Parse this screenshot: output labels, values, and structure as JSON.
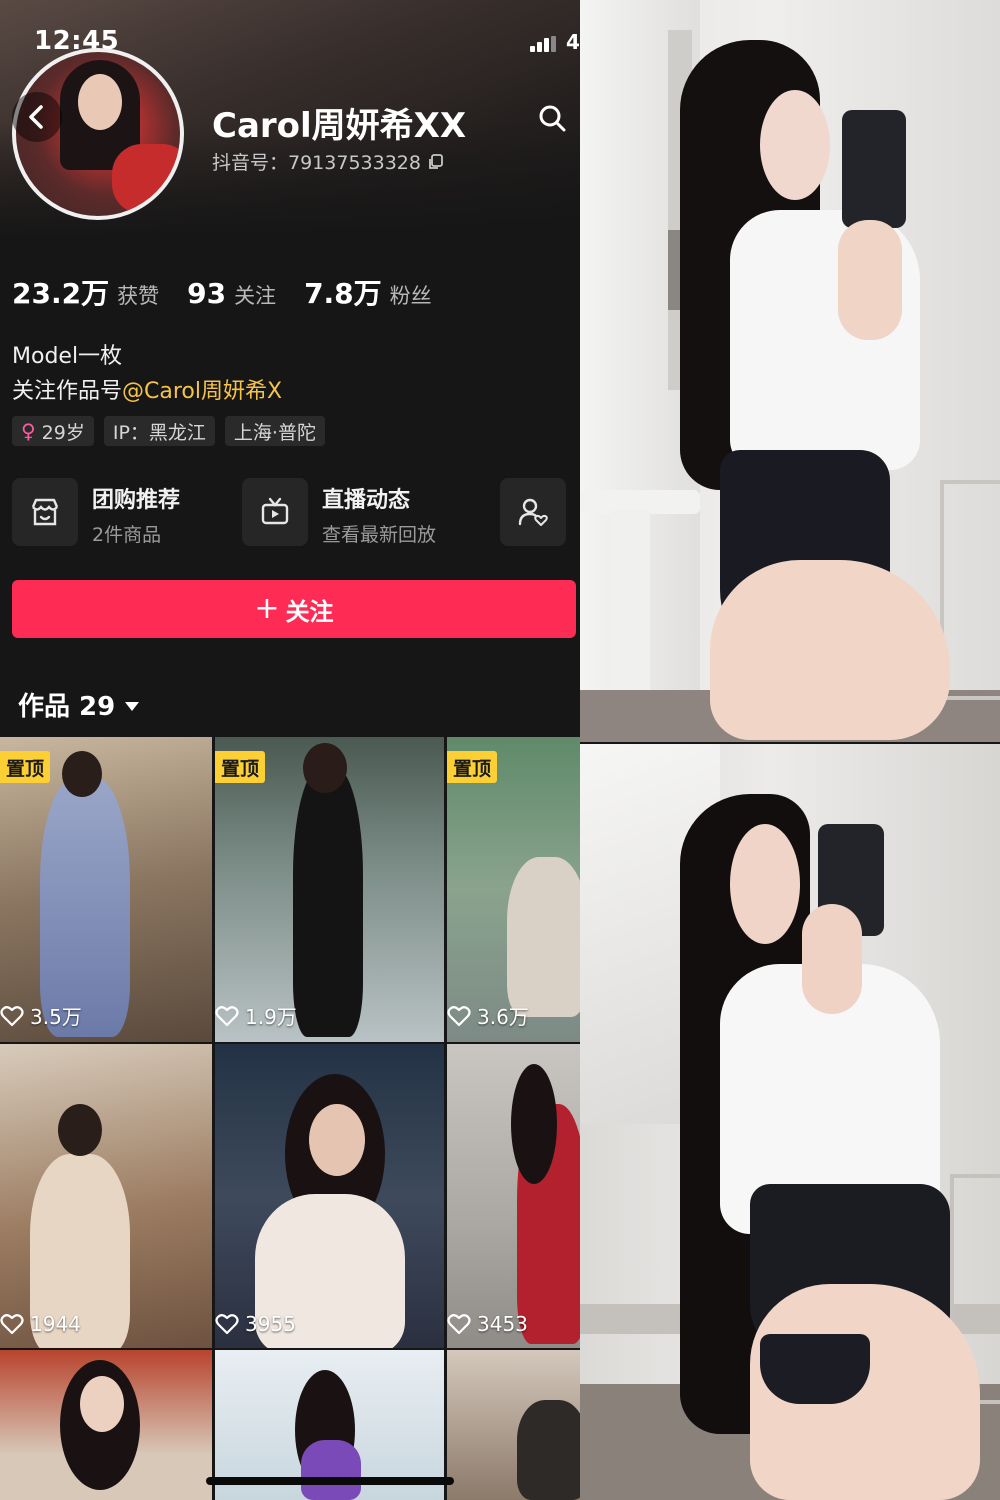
{
  "status_bar": {
    "time": "12:45",
    "battery": "4"
  },
  "profile": {
    "name": "Carol周妍希XX",
    "douyin_id": "抖音号：79137533328",
    "stats": [
      {
        "value": "23.2万",
        "label": "获赞"
      },
      {
        "value": "93",
        "label": "关注"
      },
      {
        "value": "7.8万",
        "label": "粉丝"
      }
    ],
    "bio_line1": "Model一枚",
    "bio_line2_prefix": "关注作品号",
    "bio_line2_mention": "@Carol周妍希X",
    "tags": {
      "age": "29岁",
      "ip": "IP：黑龙江",
      "location": "上海·普陀"
    },
    "cards": {
      "shop": {
        "title": "团购推荐",
        "subtitle": "2件商品"
      },
      "live": {
        "title": "直播动态",
        "subtitle": "查看最新回放"
      }
    },
    "follow_label": "关注",
    "works_label": "作品 29"
  },
  "videos": [
    {
      "pinned": "置顶",
      "likes": "3.5万"
    },
    {
      "pinned": "置顶",
      "likes": "1.9万"
    },
    {
      "pinned": "置顶",
      "likes": "3.6万"
    },
    {
      "pinned": "",
      "likes": "1944"
    },
    {
      "pinned": "",
      "likes": "3955"
    },
    {
      "pinned": "",
      "likes": "3453"
    },
    {
      "pinned": "",
      "likes": ""
    },
    {
      "pinned": "",
      "likes": ""
    },
    {
      "pinned": "",
      "likes": ""
    }
  ],
  "colors": {
    "accent": "#fe2c55",
    "pin": "#fcd035",
    "mention": "#f6c34a",
    "background": "#161616"
  }
}
